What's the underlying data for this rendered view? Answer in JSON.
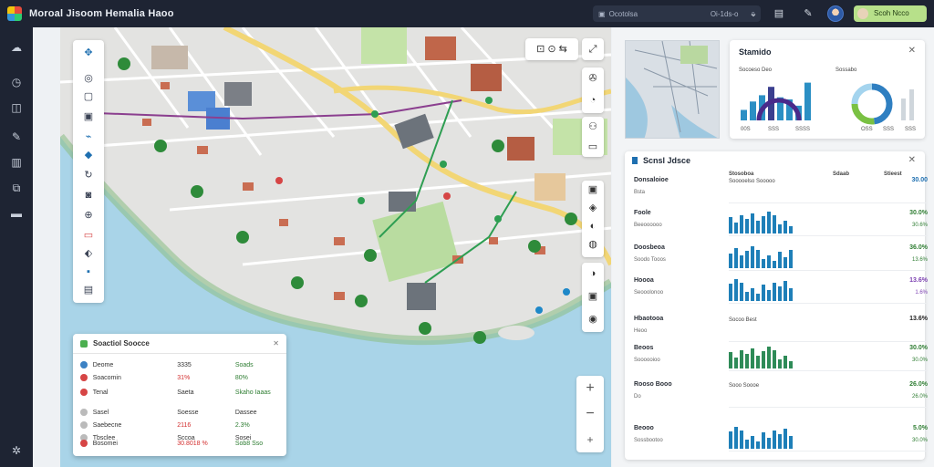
{
  "app": {
    "title": "Moroal Jisoom Hemalia Haoo"
  },
  "topbar": {
    "search_left": "Ocotolsa",
    "search_right": "Oi-1ds-o",
    "user_name": "Scoh Ncco"
  },
  "map_panel": {
    "title": "Soactiol Soocce",
    "columns": [
      "",
      "",
      ""
    ],
    "rows": [
      {
        "label": "Deome",
        "v1": "3335",
        "v2": "Soads",
        "icon_color": "#3c82c4",
        "v1_color": "#333333",
        "v2_color": "#2e7d32"
      },
      {
        "label": "Soacomin",
        "v1": "31%",
        "v2": "80%",
        "icon_color": "#d64545",
        "v1_color": "#d32f2f",
        "v2_color": "#2e7d32"
      },
      {
        "label": "Tenal",
        "v1": "Saeta",
        "v2": "Skaho Iaaas",
        "icon_color": "#d64545",
        "v1_color": "#333333",
        "v2_color": "#2e7d32"
      },
      {
        "label": "Sasel",
        "v1": "Soesse",
        "v2": "Dassee",
        "icon_color": "#bbbbbb",
        "v1_color": "#333333",
        "v2_color": "#333333"
      },
      {
        "label": "Saebecne",
        "v1": "2116",
        "v2": "2.3%",
        "icon_color": "#bbbbbb",
        "v1_color": "#d32f2f",
        "v2_color": "#2e7d32"
      },
      {
        "label": "Tbsclee",
        "v1": "Sccoa",
        "v2": "Sosei",
        "icon_color": "#bbbbbb",
        "v1_color": "#333333",
        "v2_color": "#333333"
      },
      {
        "label": "Bosomei",
        "v1": "30.8018 %",
        "v2": "Sob8 Sso",
        "icon_color": "#d64545",
        "v1_color": "#d32f2f",
        "v2_color": "#2e7d32"
      }
    ]
  },
  "stats_card": {
    "title": "Stamido",
    "left_label": "Socoeso Deo",
    "right_label": "Sossabo",
    "left_ticks": [
      "00S",
      "SSS",
      "SSSS"
    ],
    "right_ticks": [
      "OSS",
      "SSS",
      "SSS"
    ],
    "bar_values": [
      0.25,
      0.45,
      0.6,
      0.8,
      0.55,
      0.5,
      0.35,
      0.9
    ],
    "donut": [
      {
        "value": 0.48,
        "color": "#2f7fc1"
      },
      {
        "value": 0.27,
        "color": "#7ac143"
      },
      {
        "value": 0.25,
        "color": "#a4d4ee"
      }
    ]
  },
  "side_list": {
    "title": "Scnsl Jdsce",
    "header": {
      "c1": "Stosoboa",
      "c2": "Sdaab",
      "c3": "Stieest"
    },
    "sections": [
      {
        "name": "Donsaloioe",
        "sub": "Bsta",
        "bar_label": "Sooooelso Sooooo",
        "val": "30.00",
        "sub_val": "",
        "val_color": "#1e6fb0"
      },
      {
        "name": "Foole",
        "sub": "Beeoooooo",
        "bar_label": "",
        "val": "30.0%",
        "sub_val": "30.6%",
        "val_color": "#2e7d32"
      },
      {
        "name": "Doosbeoa",
        "sub": "Soodo Tooos",
        "bar_label": "",
        "val": "36.0%",
        "sub_val": "13.6%",
        "val_color": "#2e7d32"
      },
      {
        "name": "Hoooa",
        "sub": "Seooolonoo",
        "bar_label": "",
        "val": "13.6%",
        "sub_val": "1.6%",
        "val_color": "#7b3fb0"
      },
      {
        "name": "Hbaotooa",
        "sub": "Heoo",
        "bar_label": "Socoo Best",
        "val": "13.6%",
        "sub_val": "",
        "val_color": "#222222"
      },
      {
        "name": "Beoos",
        "sub": "Soooooioo",
        "bar_label": "",
        "val": "30.0%",
        "sub_val": "30.0%",
        "val_color": "#2e7d32"
      },
      {
        "name": "Rooso Booo",
        "sub": "Do",
        "bar_label": "Sooo Soooe",
        "val": "26.0%",
        "sub_val": "26.0%",
        "val_color": "#2e7d32"
      },
      {
        "name": "Beooo",
        "sub": "Sossbootoo",
        "bar_label": "",
        "val": "5.0%",
        "sub_val": "30.0%",
        "val_color": "#2e7d32"
      }
    ]
  }
}
